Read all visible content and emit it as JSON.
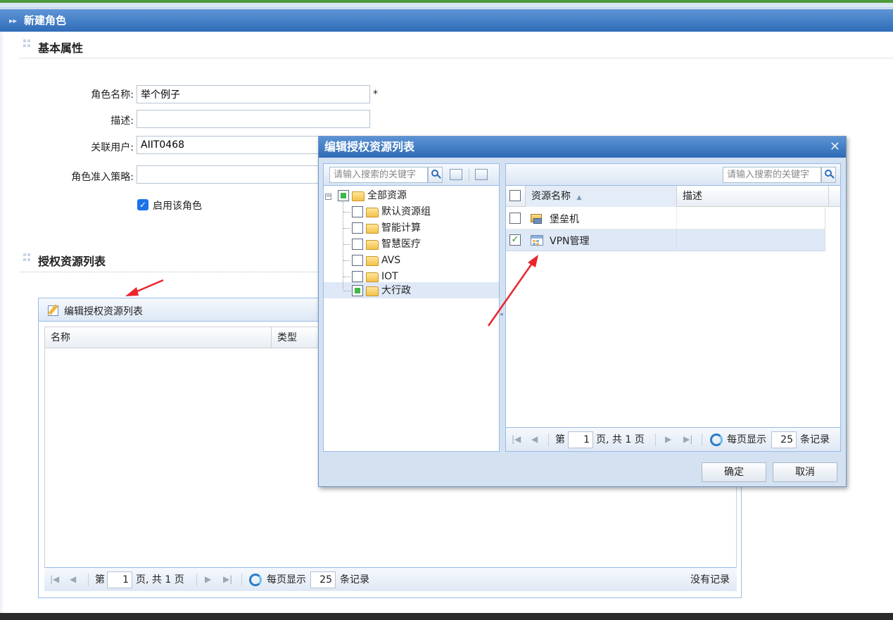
{
  "window": {
    "title": "新建角色"
  },
  "basic": {
    "section_title": "基本属性",
    "role_name_label": "角色名称:",
    "role_name_value": "举个例子",
    "required_mark": "*",
    "desc_label": "描述:",
    "desc_value": "",
    "user_label": "关联用户:",
    "user_value": "AIIT0468",
    "policy_label": "角色准入策略:",
    "policy_value": "",
    "enable_label": "启用该角色",
    "enable_checked": true
  },
  "auth": {
    "section_title": "授权资源列表",
    "edit_button": "编辑授权资源列表",
    "columns": [
      "名称",
      "类型"
    ],
    "pager": {
      "prefix": "第",
      "page": "1",
      "of": "页, 共 1 页",
      "per_page_label": "每页显示",
      "per_page": "25",
      "suffix": "条记录",
      "empty": "没有记录"
    }
  },
  "dialog": {
    "title": "编辑授权资源列表",
    "close": "✕",
    "search_placeholder": "请输入搜索的关键字",
    "tree": {
      "root": "全部资源",
      "children": [
        "默认资源组",
        "智能计算",
        "智慧医疗",
        "AVS",
        "IOT",
        "大行政"
      ]
    },
    "grid": {
      "columns": [
        "资源名称",
        "描述"
      ],
      "sort_indicator": "▲",
      "rows": [
        {
          "name": "堡垒机",
          "desc": "",
          "checked": false
        },
        {
          "name": "VPN管理",
          "desc": "",
          "checked": true
        }
      ]
    },
    "pager": {
      "prefix": "第",
      "page": "1",
      "of": "页, 共 1 页",
      "per_page_label": "每页显示",
      "per_page": "25",
      "suffix": "条记录"
    },
    "ok": "确定",
    "cancel": "取消"
  },
  "colors": {
    "title_bar": "#2f6cb8",
    "annotation_arrow": "#e8262b",
    "partial_check": "#3fb84a"
  }
}
